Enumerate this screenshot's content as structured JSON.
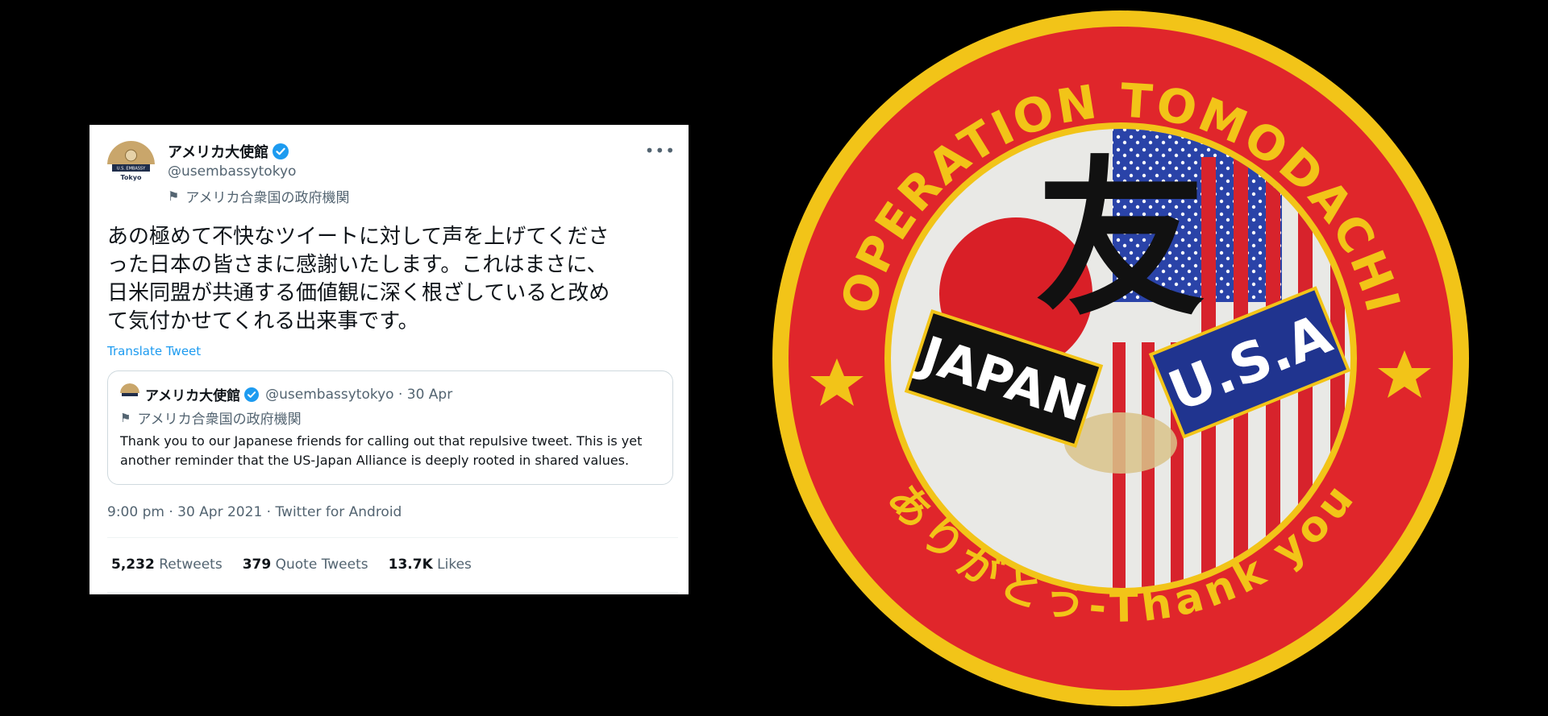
{
  "tweet": {
    "account_name": "アメリカ大使館",
    "handle": "@usembassytokyo",
    "government_label": "アメリカ合衆国の政府機関",
    "avatar_text": {
      "top": "U.S. EMBASSY",
      "bottom": "Tokyo"
    },
    "body": "あの極めて不快なツイートに対して声を上げてくださ\nった日本の皆さまに感謝いたします。これはまさに、\n日米同盟が共通する価値観に深く根ざしていると改め\nて気付かせてくれる出来事です。",
    "translate_label": "Translate Tweet",
    "quoted": {
      "account_name": "アメリカ大使館",
      "handle_and_date": "@usembassytokyo · 30 Apr",
      "government_label": "アメリカ合衆国の政府機関",
      "text": "Thank you to our Japanese friends for calling out that repulsive tweet. This is yet another reminder that the US-Japan Alliance is deeply rooted in shared values."
    },
    "timestamp": "9:00 pm · 30 Apr 2021 · Twitter for Android",
    "stats": {
      "retweets_count": "5,232",
      "retweets_label": "Retweets",
      "quotes_count": "379",
      "quotes_label": "Quote Tweets",
      "likes_count": "13.7K",
      "likes_label": "Likes"
    },
    "colors": {
      "link": "#1d9bf0",
      "secondary_text": "#536471",
      "verified": "#1d9bf0"
    }
  },
  "patch": {
    "top_arc_text": "OPERATION TOMODACHI",
    "bottom_arc_text": "ありがとう-Thank you",
    "kanji": "友",
    "left_banner": "JAPAN",
    "right_banner": "U.S.A",
    "colors": {
      "border": "#f2c418",
      "ring": "#e0262b",
      "navy": "#20348f",
      "black": "#111111"
    }
  }
}
